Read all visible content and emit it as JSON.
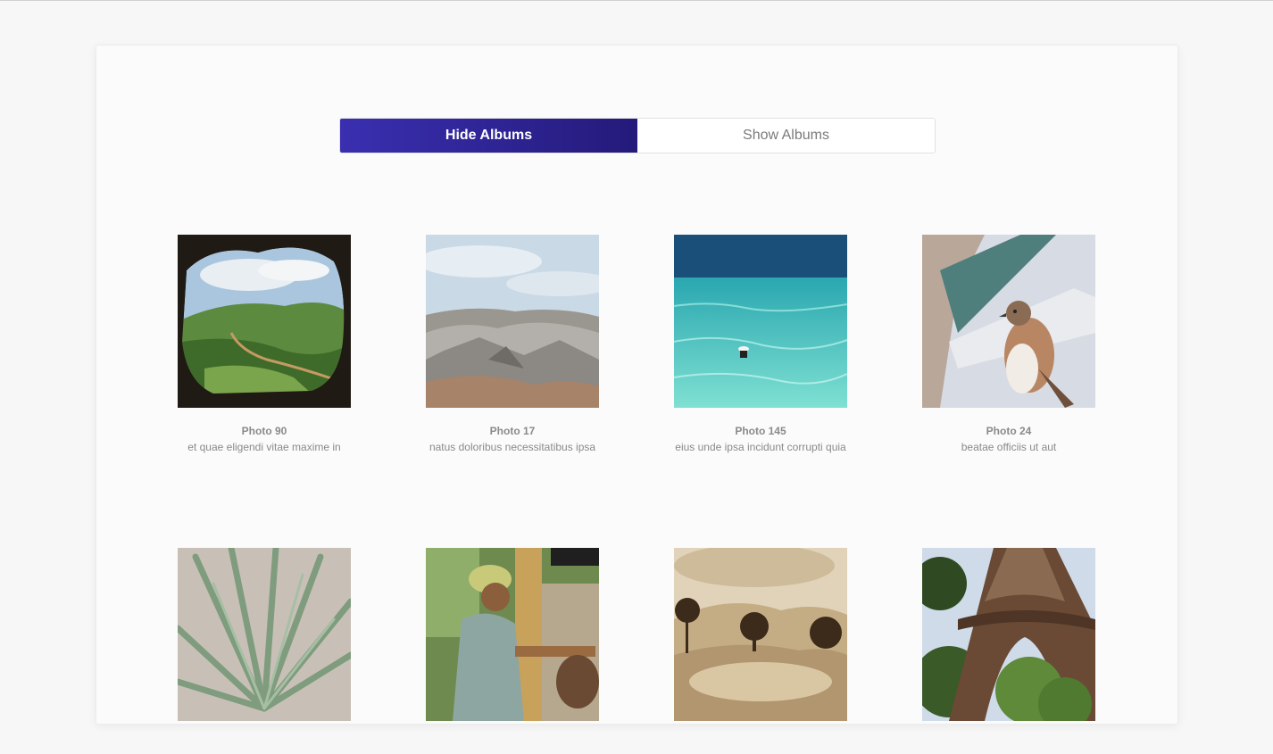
{
  "toggle": {
    "hide_label": "Hide Albums",
    "show_label": "Show Albums",
    "active": "hide"
  },
  "photos": [
    {
      "title": "Photo 90",
      "description": "et quae eligendi vitae maxime in",
      "image": "cave-valley-photo"
    },
    {
      "title": "Photo 17",
      "description": "natus doloribus necessitatibus ipsa",
      "image": "rocky-mountain-photo"
    },
    {
      "title": "Photo 145",
      "description": "eius unde ipsa incidunt corrupti quia",
      "image": "turquoise-sea-swimmer-photo"
    },
    {
      "title": "Photo 24",
      "description": "beatae officiis ut aut",
      "image": "sparrow-bird-photo"
    },
    {
      "title": "",
      "description": "",
      "image": "agave-plant-photo"
    },
    {
      "title": "",
      "description": "",
      "image": "woman-working-photo"
    },
    {
      "title": "",
      "description": "",
      "image": "sepia-hills-trees-photo"
    },
    {
      "title": "",
      "description": "",
      "image": "eiffel-tower-photo"
    }
  ],
  "colors": {
    "accent_start": "#3a2fb0",
    "accent_end": "#241a7a",
    "text_muted": "#8a8a8a"
  }
}
